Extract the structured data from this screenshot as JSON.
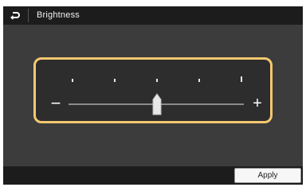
{
  "title": "Brightness",
  "icons": {
    "back": "back-arrow-icon",
    "decrease": "minus-icon",
    "increase": "plus-icon"
  },
  "slider": {
    "minus_label": "−",
    "plus_label": "+",
    "min": 1,
    "max": 5,
    "value": 3,
    "ticks": [
      1,
      2,
      3,
      4,
      5
    ]
  },
  "apply_label": "Apply",
  "colors": {
    "frame": "#f5c870",
    "titlebar": "#1c1c1c",
    "content": "#3c3c3c",
    "handle": "#e8e8e8"
  }
}
